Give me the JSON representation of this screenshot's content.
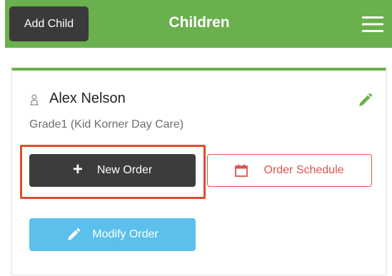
{
  "header": {
    "add_child_label": "Add Child",
    "title": "Children",
    "menu_icon": "hamburger-menu-icon"
  },
  "child": {
    "name": "Alex Nelson",
    "school": "Grade1 (Kid Korner Day Care)",
    "person_icon": "person-icon",
    "edit_icon": "pencil-edit-icon"
  },
  "actions": {
    "new_order_label": "New Order",
    "order_schedule_label": "Order Schedule",
    "modify_order_label": "Modify Order"
  },
  "colors": {
    "header_green": "#6ab04c",
    "dark_button": "#3c3c3c",
    "schedule_red": "#d9534f",
    "modify_blue": "#5bc0eb",
    "highlight_red": "#e04b2a"
  }
}
